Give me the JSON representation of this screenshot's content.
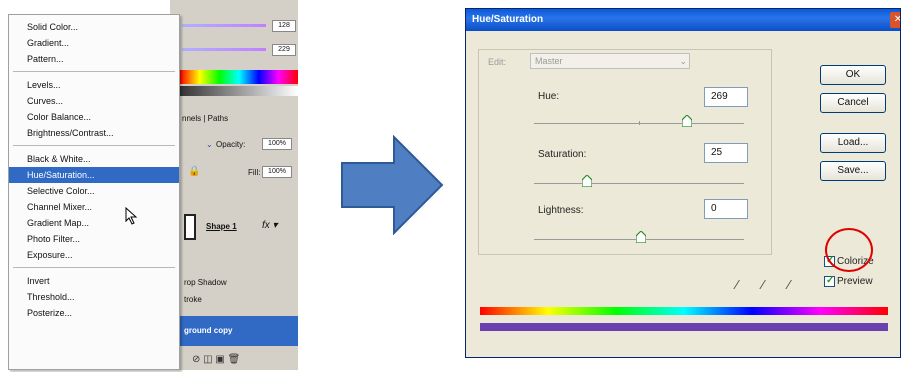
{
  "left_panel": {
    "slider_values": [
      "128",
      "229"
    ],
    "tabs_label": "nnels | Paths",
    "opacity_label": "Opacity:",
    "opacity_value": "100%",
    "fill_label": "Fill:",
    "fill_value": "100%",
    "layer_name": "Shape 1",
    "effect_drop_shadow": "rop Shadow",
    "effect_stroke": "troke",
    "selected_layer": "ground copy",
    "menu_items": [
      {
        "label": "Solid Color..."
      },
      {
        "label": "Gradient..."
      },
      {
        "label": "Pattern..."
      },
      {
        "label": "Levels..."
      },
      {
        "label": "Curves..."
      },
      {
        "label": "Color Balance..."
      },
      {
        "label": "Brightness/Contrast..."
      },
      {
        "label": "Black & White..."
      },
      {
        "label": "Hue/Saturation..."
      },
      {
        "label": "Selective Color..."
      },
      {
        "label": "Channel Mixer..."
      },
      {
        "label": "Gradient Map..."
      },
      {
        "label": "Photo Filter..."
      },
      {
        "label": "Exposure..."
      },
      {
        "label": "Invert"
      },
      {
        "label": "Threshold..."
      },
      {
        "label": "Posterize..."
      }
    ]
  },
  "dialog": {
    "title": "Hue/Saturation",
    "edit_label": "Edit:",
    "edit_value": "Master",
    "hue_label": "Hue:",
    "hue_value": "269",
    "saturation_label": "Saturation:",
    "saturation_value": "25",
    "lightness_label": "Lightness:",
    "lightness_value": "0",
    "ok_label": "OK",
    "cancel_label": "Cancel",
    "load_label": "Load...",
    "save_label": "Save...",
    "colorize_label": "Colorize",
    "preview_label": "Preview",
    "colors": {
      "result_bar": "#6a3fb0",
      "highlight_circle": "#e00000",
      "arrow": "#4f7ec2"
    }
  }
}
